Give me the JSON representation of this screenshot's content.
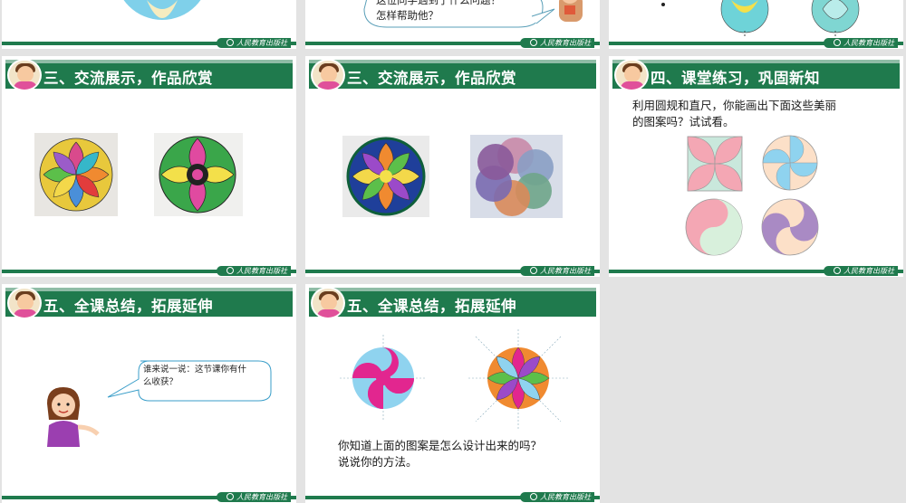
{
  "slides": [
    {
      "id": "s1",
      "header": ""
    },
    {
      "id": "s2",
      "header": "",
      "question_lines": [
        "这位同学遇到了什么问题？",
        "怎样帮助他？"
      ]
    },
    {
      "id": "s3",
      "header": ""
    },
    {
      "id": "s4",
      "header": "三、交流展示，作品欣赏"
    },
    {
      "id": "s5",
      "header": "三、交流展示，作品欣赏"
    },
    {
      "id": "s6",
      "header": "四、课堂练习，巩固新知",
      "body_lines": [
        "利用圆规和直尺，你能画出下面这些美丽",
        "的图案吗？试试看。"
      ]
    },
    {
      "id": "s7",
      "header": "五、全课总结，拓展延伸",
      "bubble_lines": [
        "谁来说一说：这节课你有什",
        "么收获？"
      ]
    },
    {
      "id": "s8",
      "header": "五、全课总结，拓展延伸",
      "body_lines": [
        "你知道上面的图案是怎么设计出来的吗？",
        "说说你的方法。"
      ]
    }
  ],
  "footer_brand": "人民教育出版社",
  "icons": [
    "teacher-avatar-icon",
    "publisher-seal-icon"
  ],
  "colors": {
    "header_green": "#1f7a4d",
    "background": "#e3e3e3"
  }
}
